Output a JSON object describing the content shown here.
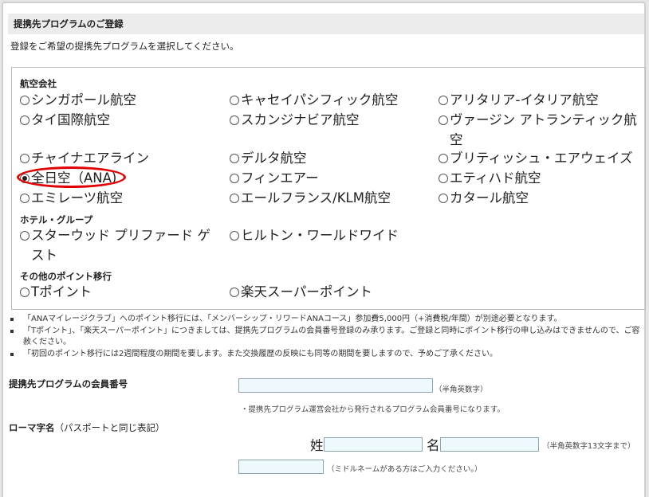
{
  "section": {
    "title": "提携先プログラムのご登録",
    "intro": "登録をご希望の提携先プログラムを選択してください。"
  },
  "categories": {
    "airlines": "航空会社",
    "hotels": "ホテル・グループ",
    "others": "その他のポイント移行"
  },
  "options": {
    "singapore": "シンガポール航空",
    "cathay": "キャセイパシフィック航空",
    "alitalia": "アリタリア-イタリア航空",
    "thai": "タイ国際航空",
    "sas": "スカンジナビア航空",
    "virgin": "ヴァージン アトランティック航空",
    "china": "チャイナエアライン",
    "delta": "デルタ航空",
    "british": "ブリティッシュ・エアウェイズ",
    "ana": "全日空（ANA)",
    "finnair": "フィンエアー",
    "etihad": "エティハド航空",
    "emirates": "エミレーツ航空",
    "afklm": "エールフランス/KLM航空",
    "qatar": "カタール航空",
    "starwood": "スターウッド プリファード ゲスト",
    "hilton": "ヒルトン・ワールドワイド",
    "tpoint": "Tポイント",
    "rakuten": "楽天スーパーポイント"
  },
  "selected_option": "ana",
  "notes": [
    "「ANAマイレージクラブ」へのポイント移行には、「メンバーシップ・リワードANAコース」参加費5,000円（+消費税/年間）が別途必要となります。",
    "「Tポイント」、「楽天スーパーポイント」につきましては、提携先プログラムの会員番号登録のみ承ります。ご登録と同時にポイント移行の申し込みはできませんので、ご容赦ください。",
    "「初回のポイント移行には2週間程度の期間を要します。また交換履歴の反映にも同等の期間を要しますので、予めご了承ください。"
  ],
  "member_number": {
    "label": "提携先プログラムの会員番号",
    "value": "",
    "hint": "（半角英数字）",
    "note": "・提携先プログラム運営会社から発行されるプログラム会員番号になります。"
  },
  "romaji": {
    "label": "ローマ字名",
    "label_sub": "（パスポートと同じ表記）",
    "last_label": "姓",
    "first_label": "名",
    "last_value": "",
    "first_value": "",
    "middle_value": "",
    "hint": "（半角英数字13文字まで）",
    "middle_hint": "（ミドルネームがある方はご入力ください。）"
  },
  "colors": {
    "highlight_ring": "#e00000",
    "input_bg": "#eef9fd",
    "header_bg": "#ececec"
  }
}
